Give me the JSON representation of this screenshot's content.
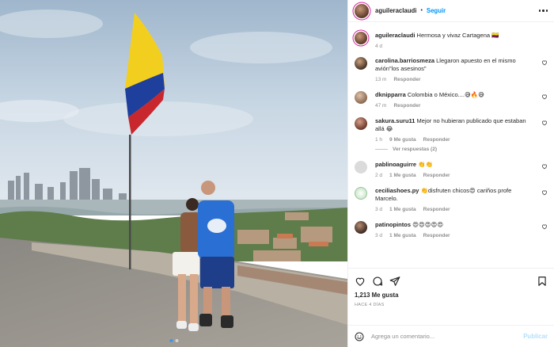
{
  "post": {
    "username": "aguileraclaudi",
    "follow_label": "Seguir",
    "separator": "•",
    "caption_text": "Hermosa y vivaz Cartagena 🇨🇴",
    "caption_time": "4 d"
  },
  "comments": [
    {
      "user": "carolina.barriosmeza",
      "text": "Llegaron apuesto en el mismo avión\"los asesinos\"",
      "time": "13 m",
      "likes": "",
      "reply": "Responder",
      "replies": ""
    },
    {
      "user": "dknipparra",
      "text": "Colombia o México....😅🔥😅",
      "time": "47 m",
      "likes": "",
      "reply": "Responder",
      "replies": ""
    },
    {
      "user": "sakura.suru11",
      "text": "Mejor no hubieran publicado que estaban allá 😂",
      "time": "1 h",
      "likes": "9 Me gusta",
      "reply": "Responder",
      "replies": "Ver respuestas (2)"
    },
    {
      "user": "pablinoaguirre",
      "text": "👏👏",
      "time": "2 d",
      "likes": "1 Me gusta",
      "reply": "Responder",
      "replies": ""
    },
    {
      "user": "ceciliashoes.py",
      "text": "👏disfruten chicos😍 cariños profe Marcelo.",
      "time": "3 d",
      "likes": "1 Me gusta",
      "reply": "Responder",
      "replies": ""
    },
    {
      "user": "patinopintos",
      "text": "😍😍😍😍😍",
      "time": "3 d",
      "likes": "1 Me gusta",
      "reply": "Responder",
      "replies": ""
    }
  ],
  "actions": {
    "likes": "1,213 Me gusta",
    "ago": "HACE 4 DÍAS"
  },
  "add_comment": {
    "placeholder": "Agrega un comentario...",
    "publish_label": "Publicar"
  },
  "icons": [
    "more-icon",
    "heart-icon",
    "comment-icon",
    "share-icon",
    "bookmark-icon",
    "emoji-icon"
  ],
  "colors": {
    "accent": "#0095f6",
    "muted": "#8e8e8e",
    "publish_disabled": "#b2dffc"
  }
}
